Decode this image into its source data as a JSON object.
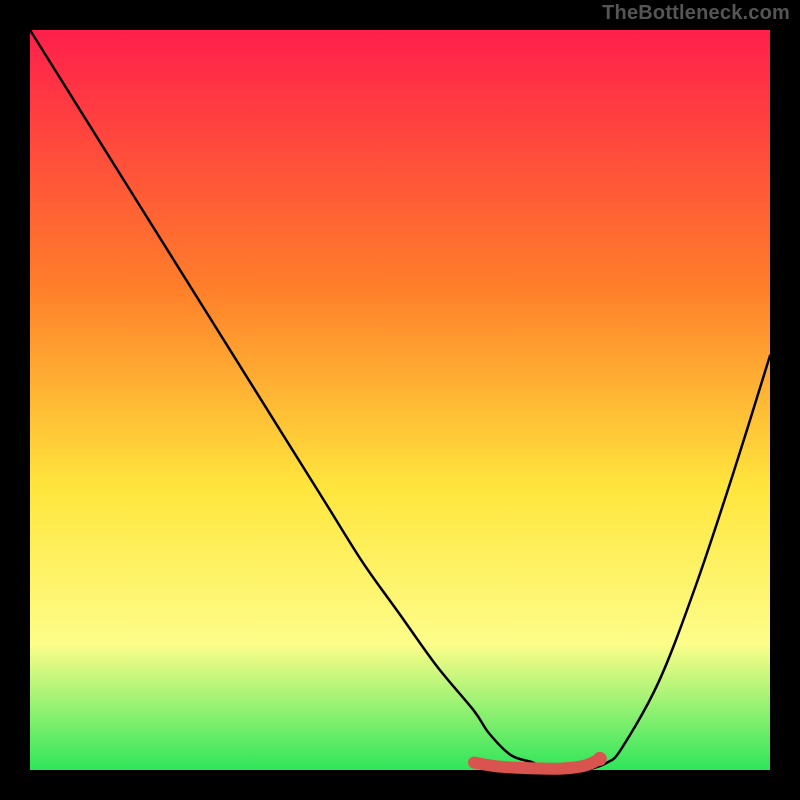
{
  "watermark": "TheBottleneck.com",
  "colors": {
    "frame": "#000000",
    "gradient_top": "#ff1f4b",
    "gradient_mid1": "#ff7f2a",
    "gradient_mid2": "#ffe63d",
    "gradient_mid3": "#fdfd8a",
    "gradient_bottom": "#2ee55a",
    "curve_stroke": "#000000",
    "marker_stroke": "#d9544f",
    "marker_fill": "#d9544f"
  },
  "chart_data": {
    "type": "line",
    "title": "",
    "xlabel": "",
    "ylabel": "",
    "xlim": [
      0,
      100
    ],
    "ylim": [
      0,
      100
    ],
    "grid": false,
    "legend": false,
    "series": [
      {
        "name": "bottleneck-curve",
        "x": [
          0,
          5,
          10,
          15,
          20,
          25,
          30,
          35,
          40,
          45,
          50,
          55,
          60,
          62,
          65,
          68,
          70,
          72,
          75,
          78,
          80,
          85,
          90,
          95,
          100
        ],
        "y": [
          100,
          92,
          84,
          76,
          68,
          60,
          52,
          44,
          36,
          28,
          21,
          14,
          8,
          5,
          2,
          1,
          0,
          0,
          0,
          1,
          3,
          12,
          25,
          40,
          56
        ]
      }
    ],
    "highlight": {
      "name": "optimal-range-marker",
      "x": [
        60,
        63,
        66,
        69,
        72,
        75,
        77
      ],
      "y": [
        1,
        0.5,
        0.3,
        0.2,
        0.2,
        0.6,
        1.5
      ]
    },
    "highlight_point": {
      "x": 77,
      "y": 1.5
    }
  }
}
